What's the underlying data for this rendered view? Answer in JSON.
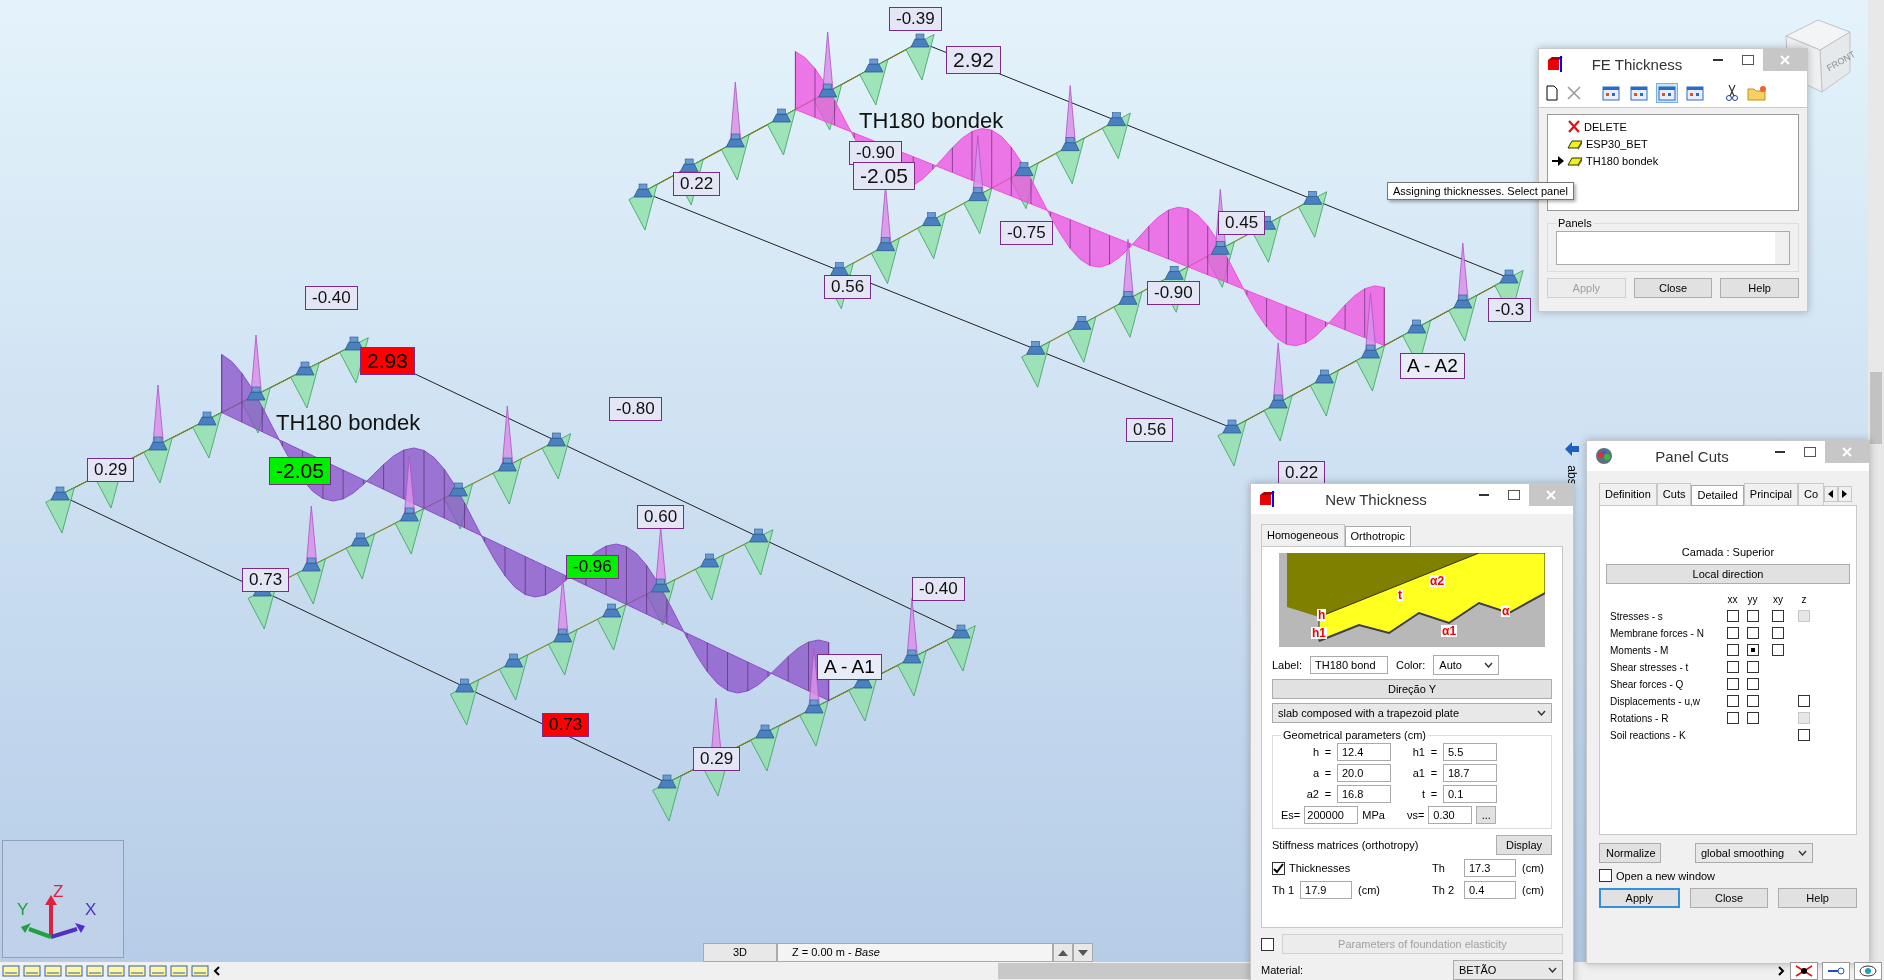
{
  "viewport": {
    "values": [
      {
        "text": "-0.39",
        "kind": "value"
      },
      {
        "text": "2.92",
        "kind": "value"
      },
      {
        "text": "-0.90",
        "kind": "value"
      },
      {
        "text": "-2.05",
        "kind": "value"
      },
      {
        "text": "0.22",
        "kind": "value"
      },
      {
        "text": "-0.75",
        "kind": "value"
      },
      {
        "text": "0.45",
        "kind": "value"
      },
      {
        "text": "0.56",
        "kind": "value"
      },
      {
        "text": "-0.90",
        "kind": "value"
      },
      {
        "text": "-0.3",
        "kind": "value"
      },
      {
        "text": "0.56",
        "kind": "value"
      },
      {
        "text": "0.22",
        "kind": "value"
      },
      {
        "text": "-0.40",
        "kind": "value"
      },
      {
        "text": "2.93",
        "kind": "max"
      },
      {
        "text": "0.29",
        "kind": "value"
      },
      {
        "text": "-2.05",
        "kind": "min"
      },
      {
        "text": "-0.80",
        "kind": "value"
      },
      {
        "text": "0.60",
        "kind": "value"
      },
      {
        "text": "-0.96",
        "kind": "min"
      },
      {
        "text": "0.73",
        "kind": "value"
      },
      {
        "text": "-0.40",
        "kind": "value"
      },
      {
        "text": "0.73",
        "kind": "max"
      },
      {
        "text": "0.29",
        "kind": "value"
      }
    ],
    "panel_names": [
      "TH180 bondek",
      "TH180 bondek"
    ],
    "section_labels": [
      "A - A2",
      "A - A1"
    ],
    "tooltip": "Assigning thicknesses. Select panel",
    "view_cube": "FRONT",
    "axes": [
      "Z",
      "Y",
      "X"
    ],
    "side_tab": "abs"
  },
  "fe_thickness": {
    "title": "FE Thickness",
    "items": [
      {
        "label": "DELETE",
        "kind": "delete",
        "current": false
      },
      {
        "label": "ESP30_BET",
        "kind": "thickness",
        "current": false
      },
      {
        "label": "TH180 bondek",
        "kind": "thickness",
        "current": true
      }
    ],
    "panels_label": "Panels",
    "buttons": [
      {
        "label": "Apply",
        "disabled": true
      },
      {
        "label": "Close",
        "disabled": false
      },
      {
        "label": "Help",
        "disabled": false
      }
    ]
  },
  "new_thickness": {
    "title": "New Thickness",
    "tabs": [
      {
        "label": "Homogeneous",
        "selected": false
      },
      {
        "label": "Orthotropic",
        "selected": true
      }
    ],
    "diagram_labels": [
      "h",
      "h1",
      "t",
      "α2",
      "α1",
      "α"
    ],
    "label_caption": "Label:",
    "label_value": "TH180 bond",
    "color_caption": "Color:",
    "color_value": "Auto",
    "direction_button": "Direção Y",
    "plate_type": "slab composed with a trapezoid plate",
    "geom_title": "Geometrical parameters (cm)",
    "params": [
      {
        "name": "h",
        "sign": "=",
        "value": "12.4"
      },
      {
        "name": "h1",
        "sign": "=",
        "value": "5.5"
      },
      {
        "name": "a",
        "sign": "=",
        "value": "20.0"
      },
      {
        "name": "a1",
        "sign": "=",
        "value": "18.7"
      },
      {
        "name": "a2",
        "sign": "=",
        "value": "16.8"
      },
      {
        "name": "t",
        "sign": "=",
        "value": "0.1"
      }
    ],
    "es_caption": "Es=",
    "es_value": "200000",
    "es_unit": "MPa",
    "nu_caption": "νs=",
    "nu_value": "0.30",
    "more_button": "...",
    "stiffness_caption": "Stiffness matrices (orthotropy)",
    "display_button": "Display",
    "thicknesses": {
      "label": "Thicknesses",
      "checked": true
    },
    "th": [
      {
        "name": "Th",
        "value": "17.3",
        "unit": "(cm)"
      },
      {
        "name": "Th 1",
        "value": "17.9",
        "unit": "(cm)"
      },
      {
        "name": "Th 2",
        "value": "0.4",
        "unit": "(cm)"
      }
    ],
    "foundation": {
      "label": "Parameters of foundation elasticity",
      "checked": false,
      "disabled": true
    },
    "material_caption": "Material:",
    "material_value": "BETÃO"
  },
  "panel_cuts": {
    "title": "Panel Cuts",
    "tabs": [
      {
        "label": "Definition",
        "selected": false
      },
      {
        "label": "Cuts",
        "selected": false
      },
      {
        "label": "Detailed",
        "selected": true
      },
      {
        "label": "Principal",
        "selected": false
      },
      {
        "label": "Co",
        "selected": false
      }
    ],
    "layer": "Camada : Superior",
    "local_direction": "Local direction",
    "columns": [
      "xx",
      "yy",
      "xy",
      "z"
    ],
    "rows": [
      {
        "label": "Stresses - s",
        "cells": [
          {
            "kind": "box",
            "checked": false
          },
          {
            "kind": "box",
            "checked": false
          },
          {
            "kind": "box",
            "checked": false
          },
          {
            "kind": "disabled",
            "checked": false
          }
        ]
      },
      {
        "label": "Membrane forces - N",
        "cells": [
          {
            "kind": "box",
            "checked": false
          },
          {
            "kind": "box",
            "checked": false
          },
          {
            "kind": "box",
            "checked": false
          },
          {
            "kind": "none"
          }
        ]
      },
      {
        "label": "Moments - M",
        "cells": [
          {
            "kind": "box",
            "checked": false
          },
          {
            "kind": "box",
            "checked": true
          },
          {
            "kind": "box",
            "checked": false
          },
          {
            "kind": "none"
          }
        ]
      },
      {
        "label": "Shear stresses - t",
        "cells": [
          {
            "kind": "box",
            "checked": false
          },
          {
            "kind": "box",
            "checked": false
          },
          {
            "kind": "none"
          },
          {
            "kind": "none"
          }
        ]
      },
      {
        "label": "Shear forces - Q",
        "cells": [
          {
            "kind": "box",
            "checked": false
          },
          {
            "kind": "box",
            "checked": false
          },
          {
            "kind": "none"
          },
          {
            "kind": "none"
          }
        ]
      },
      {
        "label": "Displacements - u,w",
        "cells": [
          {
            "kind": "box",
            "checked": false
          },
          {
            "kind": "box",
            "checked": false
          },
          {
            "kind": "none"
          },
          {
            "kind": "box",
            "checked": false
          }
        ]
      },
      {
        "label": "Rotations - R",
        "cells": [
          {
            "kind": "box",
            "checked": false
          },
          {
            "kind": "box",
            "checked": false
          },
          {
            "kind": "none"
          },
          {
            "kind": "disabled",
            "checked": false
          }
        ]
      },
      {
        "label": "Soil reactions - K",
        "cells": [
          {
            "kind": "none"
          },
          {
            "kind": "none"
          },
          {
            "kind": "none"
          },
          {
            "kind": "box",
            "checked": false
          }
        ]
      }
    ],
    "normalize": "Normalize",
    "smoothing": "global smoothing",
    "new_window": {
      "label": "Open a new window",
      "checked": false
    },
    "buttons": [
      {
        "label": "Apply",
        "default": true
      },
      {
        "label": "Close",
        "default": false
      },
      {
        "label": "Help",
        "default": false
      }
    ]
  },
  "status": {
    "view": "3D",
    "level": "Z = 0.00 m - *Base*"
  }
}
